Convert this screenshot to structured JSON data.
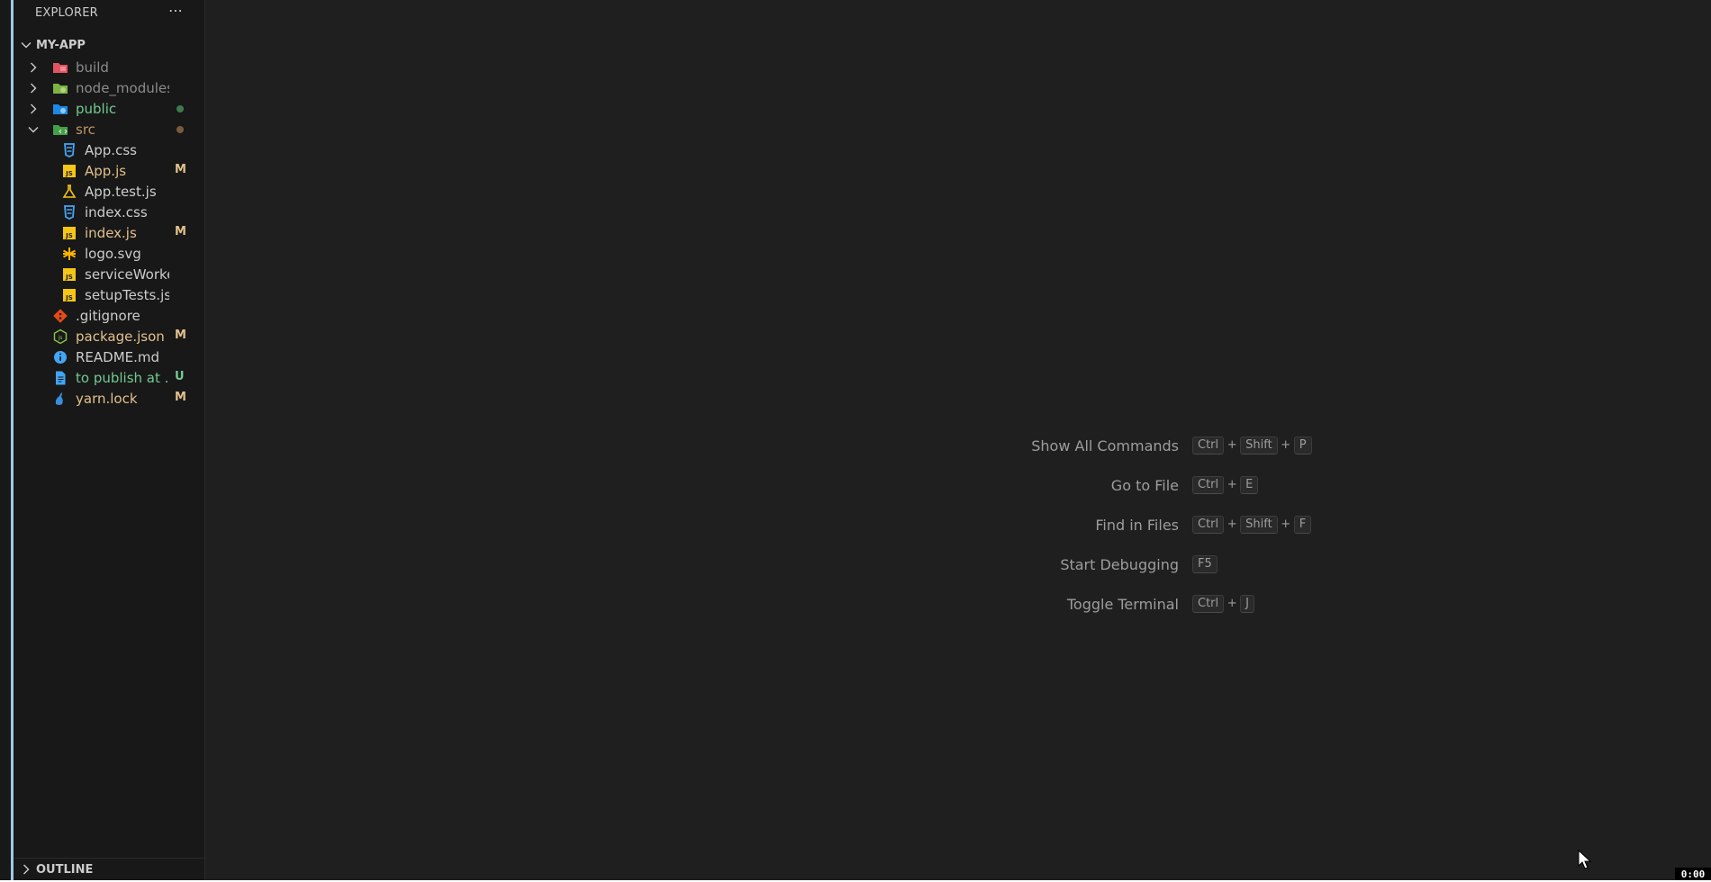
{
  "sidebar": {
    "title": "EXPLORER",
    "more_glyph": "⋯",
    "root_label": "MY-APP",
    "items": [
      {
        "label": "build",
        "icon": "folder-build-icon",
        "color": "#8b8b8b",
        "expanded": false,
        "badge": ""
      },
      {
        "label": "node_modules",
        "icon": "folder-node-icon",
        "color": "#8b8b8b",
        "expanded": false,
        "badge": ""
      },
      {
        "label": "public",
        "icon": "folder-public-icon",
        "color": "#73c991",
        "expanded": false,
        "badge": "",
        "dot": "#3f7a4f"
      },
      {
        "label": "src",
        "icon": "folder-src-icon",
        "color": "#c09168",
        "expanded": true,
        "badge": "",
        "dot": "#7a5a3c"
      },
      {
        "label": "App.css",
        "icon": "css-icon",
        "color": "#cccccc",
        "badge": ""
      },
      {
        "label": "App.js",
        "icon": "js-icon",
        "color": "#e2c08d",
        "badge": "M"
      },
      {
        "label": "App.test.js",
        "icon": "test-flask-icon",
        "color": "#cccccc",
        "badge": ""
      },
      {
        "label": "index.css",
        "icon": "css-icon",
        "color": "#cccccc",
        "badge": ""
      },
      {
        "label": "index.js",
        "icon": "js-icon",
        "color": "#e2c08d",
        "badge": "M"
      },
      {
        "label": "logo.svg",
        "icon": "svg-asterisk-icon",
        "color": "#cccccc",
        "badge": ""
      },
      {
        "label": "serviceWorker.js",
        "icon": "js-icon",
        "color": "#cccccc",
        "badge": ""
      },
      {
        "label": "setupTests.js",
        "icon": "js-icon",
        "color": "#cccccc",
        "badge": ""
      },
      {
        "label": ".gitignore",
        "icon": "git-icon",
        "color": "#cccccc",
        "badge": ""
      },
      {
        "label": "package.json",
        "icon": "nodejs-icon",
        "color": "#e2c08d",
        "badge": "M"
      },
      {
        "label": "README.md",
        "icon": "info-icon",
        "color": "#cccccc",
        "badge": ""
      },
      {
        "label": "to publish at ...",
        "icon": "document-icon",
        "color": "#73c991",
        "badge": "U"
      },
      {
        "label": "yarn.lock",
        "icon": "yarn-icon",
        "color": "#e2c08d",
        "badge": "M"
      }
    ],
    "outline_label": "OUTLINE"
  },
  "watermark": {
    "commands": [
      {
        "label": "Show All Commands",
        "keys": [
          "Ctrl",
          "Shift",
          "P"
        ]
      },
      {
        "label": "Go to File",
        "keys": [
          "Ctrl",
          "E"
        ]
      },
      {
        "label": "Find in Files",
        "keys": [
          "Ctrl",
          "Shift",
          "F"
        ]
      },
      {
        "label": "Start Debugging",
        "keys": [
          "F5"
        ]
      },
      {
        "label": "Toggle Terminal",
        "keys": [
          "Ctrl",
          "J"
        ]
      }
    ],
    "plus_sign": "+"
  },
  "timer": "0:00",
  "colors": {
    "badge_modified": "#e2c08d",
    "badge_untracked": "#73c991",
    "editor_bg": "#1f1f1f",
    "sidebar_bg": "#181818"
  }
}
